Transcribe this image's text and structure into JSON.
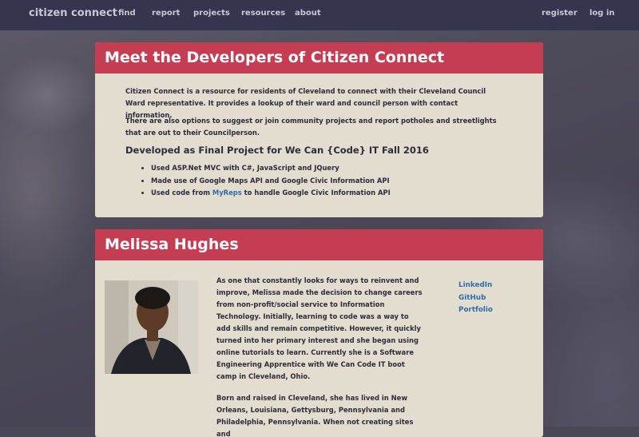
{
  "nav": {
    "brand": "citizen connect",
    "links": [
      "find",
      "report",
      "projects",
      "resources",
      "about"
    ],
    "register": "register",
    "login": "log in"
  },
  "intro": {
    "title": "Meet the Developers of Citizen Connect",
    "para1": "Citizen Connect is a resource for residents of Cleveland to connect with their Cleveland Council Ward representative. It provides a lookup of their ward and council person with contact information.",
    "para2": "There are also options to suggest or join community projects and report potholes and streetlights that are out to their Councilperson.",
    "subheading": "Developed as Final Project for We Can {Code} IT Fall 2016",
    "bullets": [
      "Used ASP.Net MVC with C#, JavaScript and JQuery",
      "Made use of Google Maps API and Google Civic Information API"
    ],
    "bullet3_prefix": "Used code from ",
    "bullet3_link": "MyReps",
    "bullet3_suffix": " to handle Google Civic Information API"
  },
  "developer": {
    "name": "Melissa Hughes",
    "bio1": "As one that constantly looks for ways to reinvent and improve, Melissa made the decision to change careers from non-profit/social service to Information Technology. Initially, learning to code was a way to add skills and remain competitive. However, it quickly turned into her primary interest and she began using online tutorials to learn. Currently she is a Software Engineering Apprentice with We Can Code IT boot camp in Cleveland, Ohio.",
    "bio2": "Born and raised in Cleveland, she has lived in New Orleans, Louisiana, Gettysburg, Pennsylvania and Philadelphia, Pennsylvania. When not creating sites and",
    "links": [
      "LinkedIn",
      "GitHub",
      "Portfolio"
    ]
  },
  "colors": {
    "nav_bg": "#36344f",
    "header_red": "#c53d52",
    "panel_bg": "#e3ddcf",
    "link_blue": "#2e6ea8"
  }
}
